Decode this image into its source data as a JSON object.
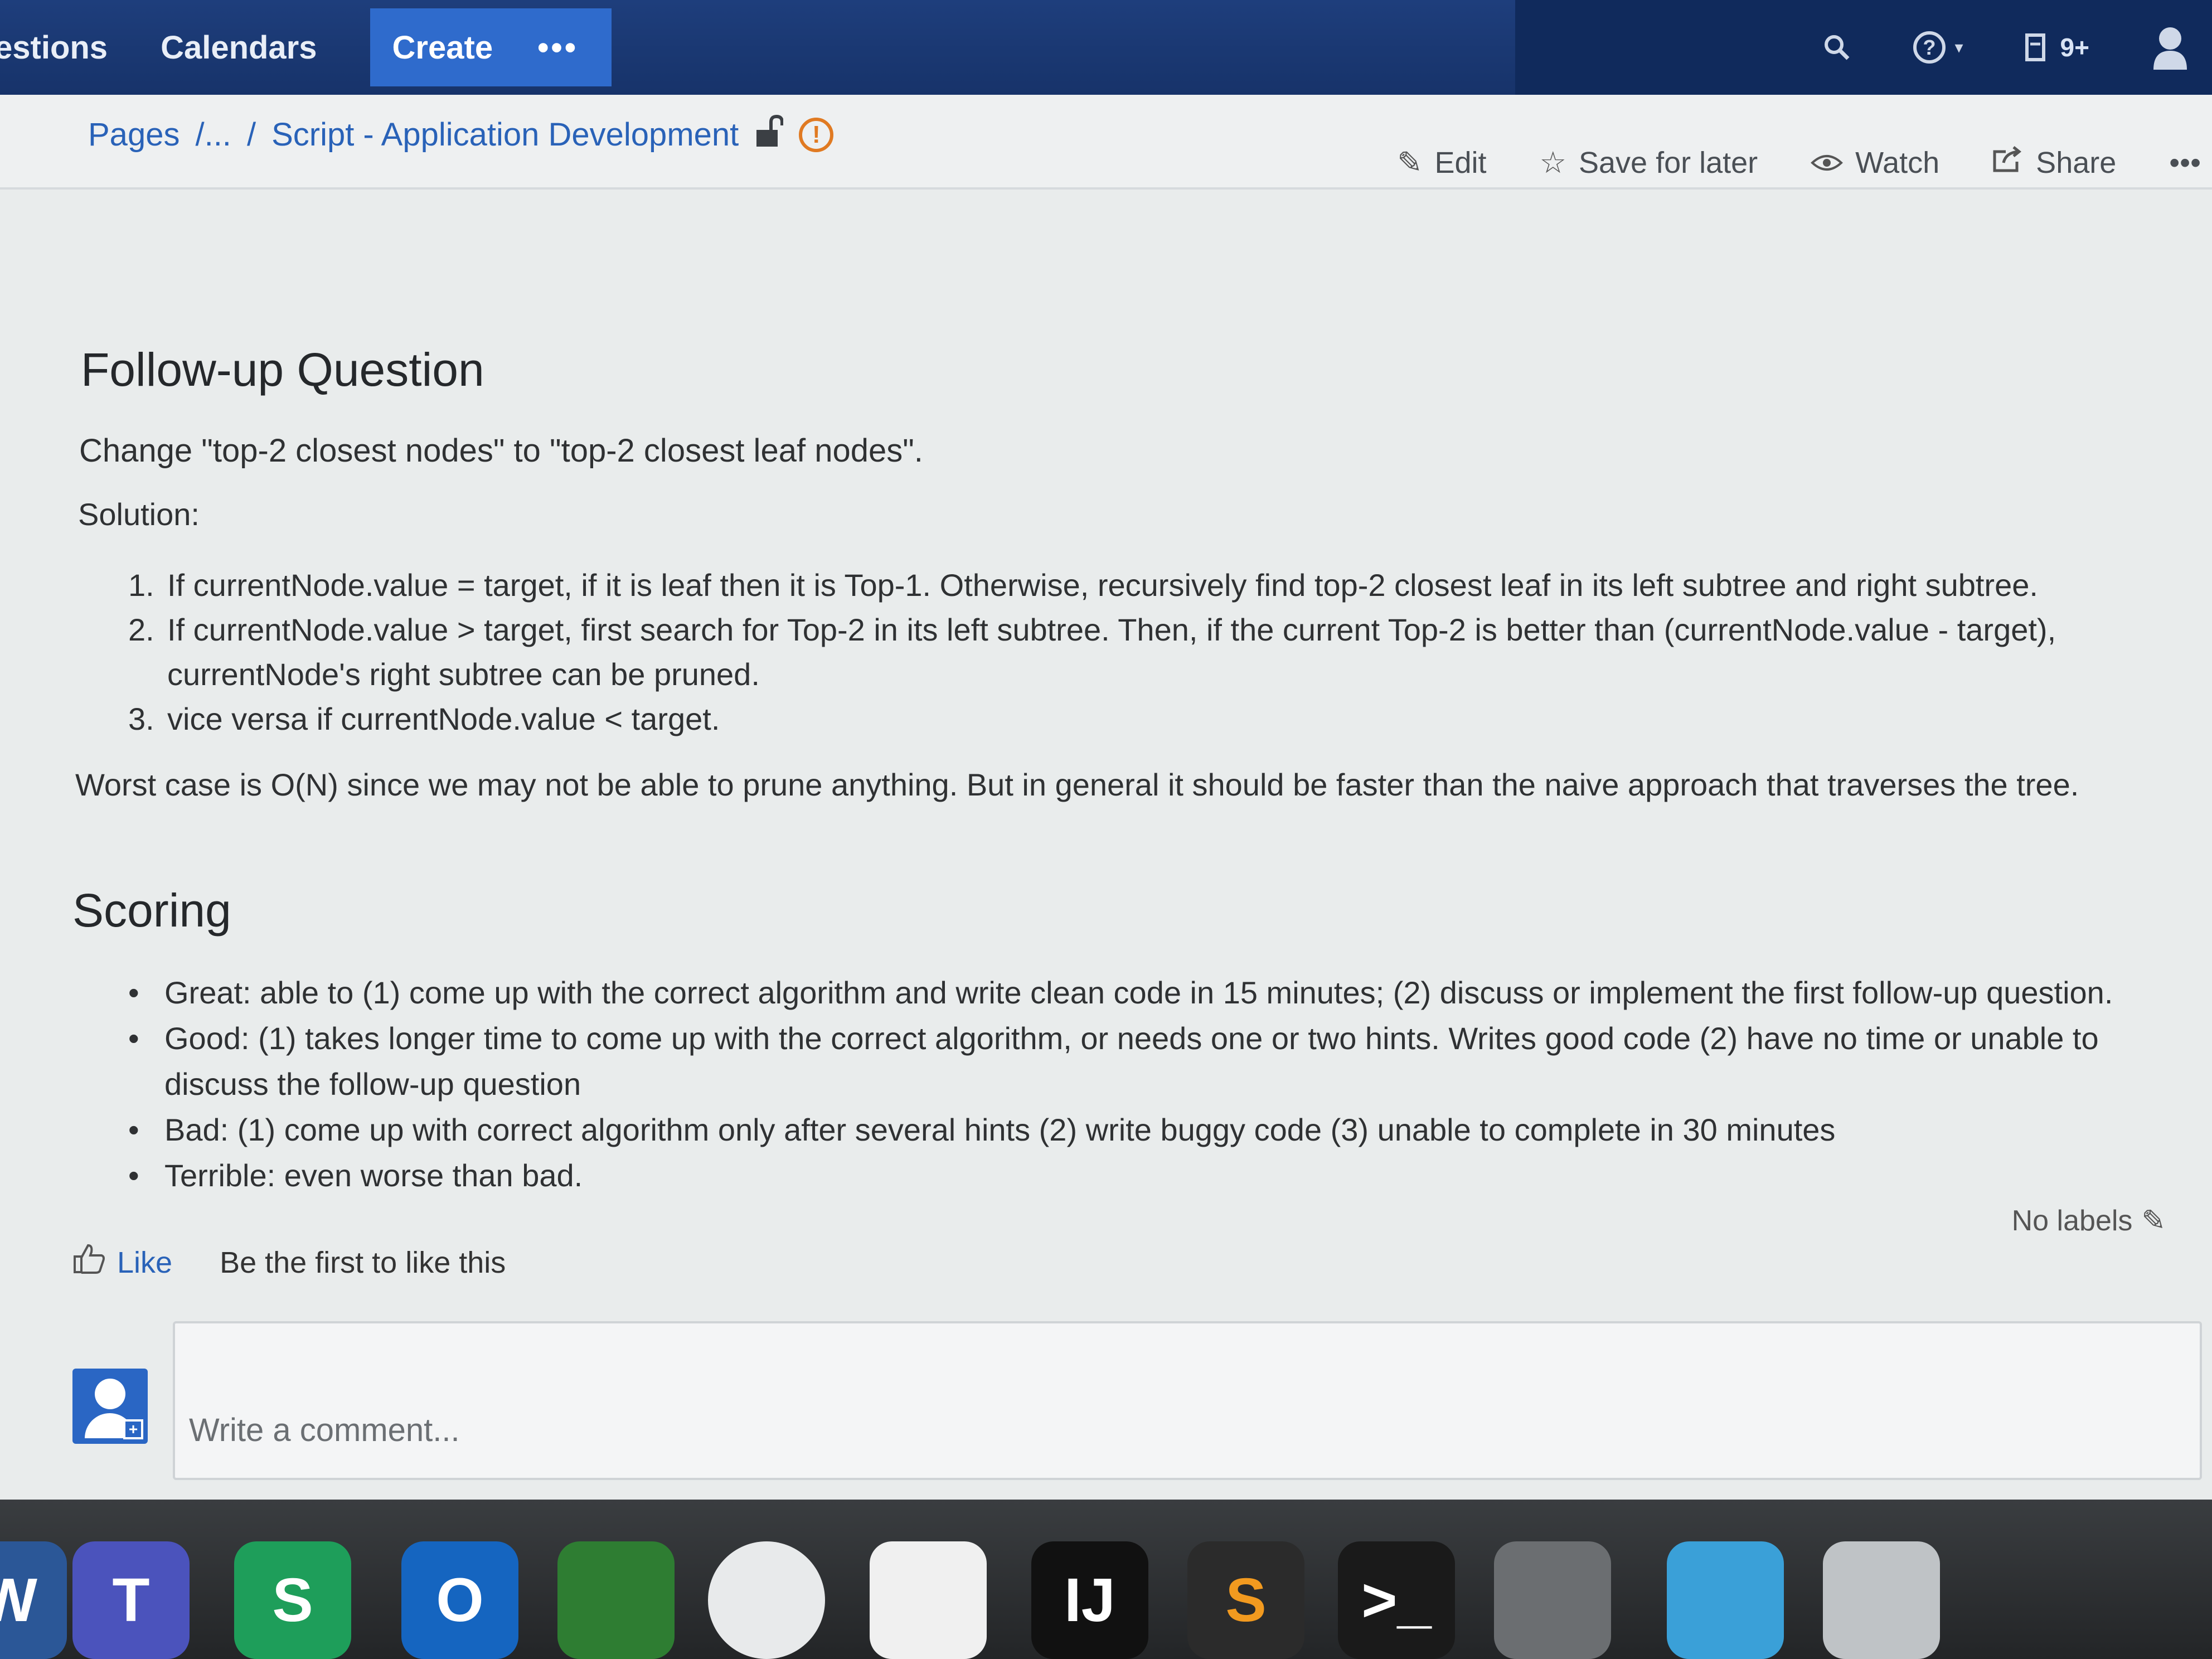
{
  "topnav": {
    "items": [
      "estions",
      "Calendars"
    ],
    "create_label": "Create",
    "more_label": "•••",
    "notifications_badge": "9+"
  },
  "breadcrumb": {
    "pages_label": "Pages",
    "ellipsis": "/...",
    "separator": "/",
    "current": "Script - Application Development",
    "warning_glyph": "!"
  },
  "page_actions": {
    "edit": "Edit",
    "save_for_later": "Save for later",
    "watch": "Watch",
    "share": "Share",
    "more": "•••"
  },
  "followup": {
    "heading": "Follow-up Question",
    "intro": "Change \"top-2 closest nodes\" to \"top-2 closest leaf nodes\".",
    "solution_label": "Solution:",
    "steps": [
      {
        "num": "1.",
        "text": "If currentNode.value = target, if it is leaf then it is Top-1. Otherwise, recursively find top-2 closest leaf in its left subtree and right subtree."
      },
      {
        "num": "2.",
        "text": "If currentNode.value > target, first search for Top-2 in its left subtree. Then, if the current Top-2 is better than (currentNode.value - target), currentNode's right subtree can be pruned."
      },
      {
        "num": "3.",
        "text": "vice versa if currentNode.value < target."
      }
    ],
    "worst_case": "Worst case is O(N) since we may not be able to prune anything. But in general it should be faster than the naive approach that traverses the tree."
  },
  "scoring": {
    "heading": "Scoring",
    "items": [
      "Great: able to (1) come up with the correct algorithm and write clean code in 15 minutes; (2) discuss or implement the first follow-up question.",
      "Good: (1) takes longer time to come up with the correct algorithm, or needs one or two hints. Writes good code (2) have no time or unable to discuss the follow-up question",
      "Bad: (1) come up with correct algorithm only after several hints (2) write buggy code (3) unable to complete in 30 minutes",
      "Terrible: even worse than bad."
    ]
  },
  "labels": {
    "text": "No labels"
  },
  "like": {
    "button": "Like",
    "text": "Be the first to like this"
  },
  "comment": {
    "placeholder": "Write a comment..."
  },
  "dock": {
    "apps": [
      {
        "name": "word",
        "glyph": "W",
        "color": "#2b5797"
      },
      {
        "name": "teams",
        "glyph": "T",
        "color": "#4b53bc"
      },
      {
        "name": "skype-for-business",
        "glyph": "S",
        "color": "#1e9e5a"
      },
      {
        "name": "outlook",
        "glyph": "O",
        "color": "#1565c0"
      },
      {
        "name": "vpn-client",
        "glyph": "",
        "color": "#2e7d32"
      },
      {
        "name": "wifi-app",
        "glyph": "",
        "color": "#e8eaeb"
      },
      {
        "name": "slack",
        "glyph": "",
        "color": "#f0f0f0"
      },
      {
        "name": "intellij",
        "glyph": "IJ",
        "color": "#111111"
      },
      {
        "name": "sublime-text",
        "glyph": "S",
        "color": "#2b2b2b"
      },
      {
        "name": "terminal",
        "glyph": ">_",
        "color": "#1a1a1a"
      },
      {
        "name": "system-preferences",
        "glyph": "",
        "color": "#6b6e71"
      },
      {
        "name": "downloads-folder",
        "glyph": "",
        "color": "#3aa0d8"
      },
      {
        "name": "trash",
        "glyph": "",
        "color": "#bfc3c6"
      }
    ]
  }
}
